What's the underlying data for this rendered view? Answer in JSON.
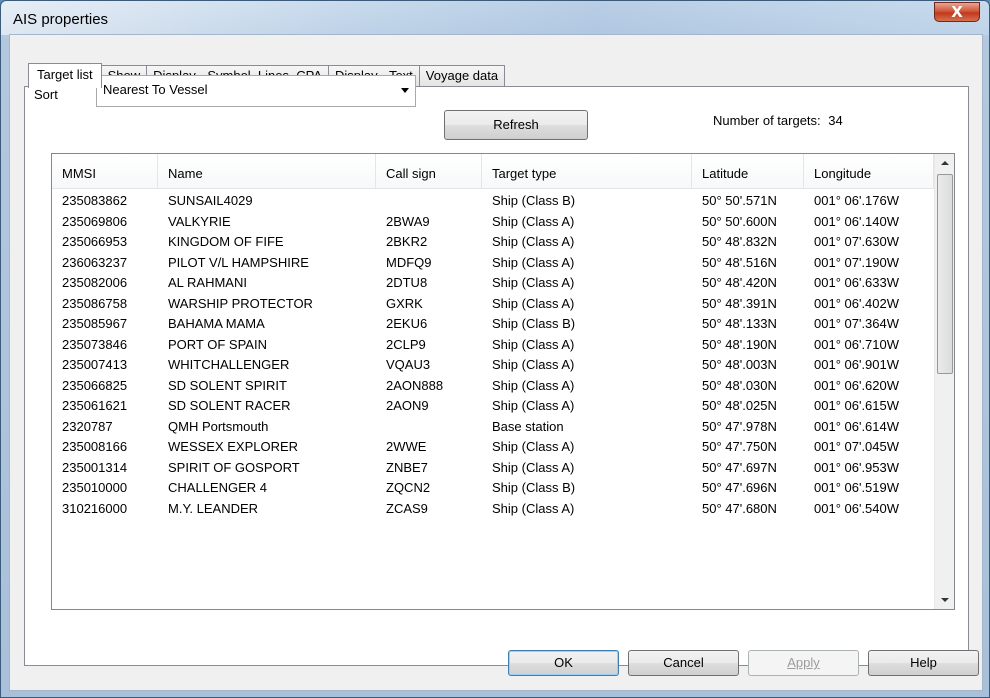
{
  "window": {
    "title": "AIS properties",
    "close_glyph": "X"
  },
  "tabs": [
    {
      "label": "Target list",
      "active": true
    },
    {
      "label": "Show"
    },
    {
      "label": "Display - Symbol, Lines, CPA"
    },
    {
      "label": "Display - Text"
    },
    {
      "label": "Voyage data"
    }
  ],
  "sort": {
    "label": "Sort",
    "value": "Nearest To Vessel"
  },
  "refresh_label": "Refresh",
  "targets_count": {
    "label": "Number of targets:",
    "value": "34"
  },
  "table": {
    "columns": [
      "MMSI",
      "Name",
      "Call sign",
      "Target type",
      "Latitude",
      "Longitude"
    ],
    "rows": [
      [
        "235083862",
        "SUNSAIL4029",
        "",
        "Ship (Class B)",
        "50° 50'.571N",
        "001° 06'.176W"
      ],
      [
        "235069806",
        "VALKYRIE",
        "2BWA9",
        "Ship (Class A)",
        "50° 50'.600N",
        "001° 06'.140W"
      ],
      [
        "235066953",
        "KINGDOM OF FIFE",
        "2BKR2",
        "Ship (Class A)",
        "50° 48'.832N",
        "001° 07'.630W"
      ],
      [
        "236063237",
        "PILOT V/L HAMPSHIRE",
        "MDFQ9",
        "Ship (Class A)",
        "50° 48'.516N",
        "001° 07'.190W"
      ],
      [
        "235082006",
        "AL RAHMANI",
        "2DTU8",
        "Ship (Class A)",
        "50° 48'.420N",
        "001° 06'.633W"
      ],
      [
        "235086758",
        "WARSHIP PROTECTOR",
        "GXRK",
        "Ship (Class A)",
        "50° 48'.391N",
        "001° 06'.402W"
      ],
      [
        "235085967",
        "BAHAMA MAMA",
        "2EKU6",
        "Ship (Class B)",
        "50° 48'.133N",
        "001° 07'.364W"
      ],
      [
        "235073846",
        "PORT OF SPAIN",
        "2CLP9",
        "Ship (Class A)",
        "50° 48'.190N",
        "001° 06'.710W"
      ],
      [
        "235007413",
        "WHITCHALLENGER",
        "VQAU3",
        "Ship (Class A)",
        "50° 48'.003N",
        "001° 06'.901W"
      ],
      [
        "235066825",
        "SD SOLENT SPIRIT",
        "2AON888",
        "Ship (Class A)",
        "50° 48'.030N",
        "001° 06'.620W"
      ],
      [
        "235061621",
        "SD SOLENT RACER",
        "2AON9",
        "Ship (Class A)",
        "50° 48'.025N",
        "001° 06'.615W"
      ],
      [
        "2320787",
        "QMH Portsmouth",
        "",
        "Base station",
        "50° 47'.978N",
        "001° 06'.614W"
      ],
      [
        "235008166",
        "WESSEX EXPLORER",
        "2WWE",
        "Ship (Class A)",
        "50° 47'.750N",
        "001° 07'.045W"
      ],
      [
        "235001314",
        "SPIRIT OF GOSPORT",
        "ZNBE7",
        "Ship (Class A)",
        "50° 47'.697N",
        "001° 06'.953W"
      ],
      [
        "235010000",
        "CHALLENGER 4",
        "ZQCN2",
        "Ship (Class B)",
        "50° 47'.696N",
        "001° 06'.519W"
      ],
      [
        "310216000",
        "M.Y. LEANDER",
        "ZCAS9",
        "Ship (Class A)",
        "50° 47'.680N",
        "001° 06'.540W"
      ]
    ]
  },
  "buttons": {
    "ok": "OK",
    "cancel": "Cancel",
    "apply": "Apply",
    "help": "Help"
  },
  "icons": {
    "close": "close-icon",
    "dropdown": "chevron-down-icon",
    "scroll_up": "arrow-up-icon",
    "scroll_down": "arrow-down-icon"
  }
}
